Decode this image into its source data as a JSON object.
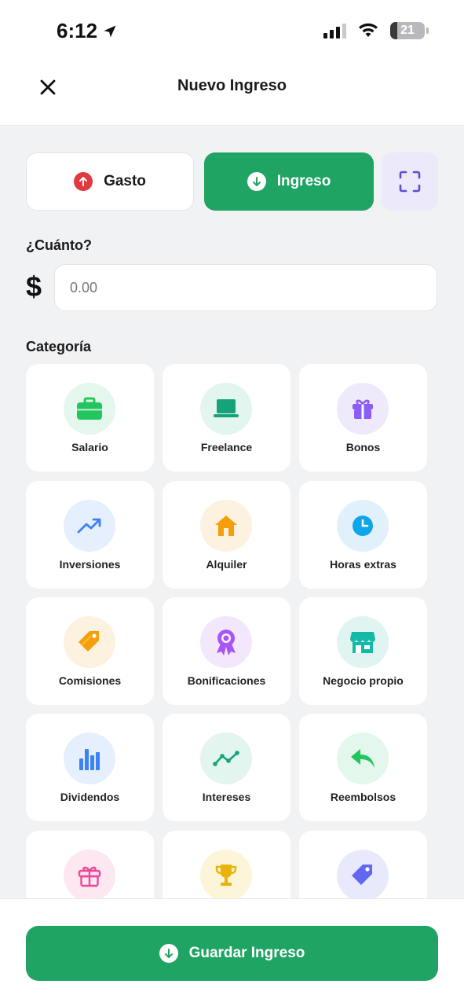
{
  "status_bar": {
    "time": "6:12",
    "battery_level": "21"
  },
  "header": {
    "title": "Nuevo Ingreso"
  },
  "type_toggle": {
    "expense_label": "Gasto",
    "income_label": "Ingreso",
    "selected": "Ingreso",
    "income_color": "#1fa463",
    "expense_icon_color": "#e0393e"
  },
  "amount": {
    "label": "¿Cuánto?",
    "currency_symbol": "$",
    "placeholder": "0.00",
    "value": ""
  },
  "category": {
    "label": "Categoría",
    "items": [
      {
        "label": "Salario",
        "icon": "briefcase-icon",
        "icon_color": "#22c55e",
        "bg": "#e4f7ec"
      },
      {
        "label": "Freelance",
        "icon": "laptop-icon",
        "icon_color": "#16a37a",
        "bg": "#e2f5ee"
      },
      {
        "label": "Bonos",
        "icon": "gift-icon",
        "icon_color": "#8b5cf6",
        "bg": "#efe9fc"
      },
      {
        "label": "Inversiones",
        "icon": "trending-up-icon",
        "icon_color": "#3b82f6",
        "bg": "#e6effd"
      },
      {
        "label": "Alquiler",
        "icon": "home-icon",
        "icon_color": "#f59e0b",
        "bg": "#fdf1df"
      },
      {
        "label": "Horas extras",
        "icon": "clock-icon",
        "icon_color": "#0ea5e9",
        "bg": "#e1f1fb"
      },
      {
        "label": "Comisiones",
        "icon": "tag-icon",
        "icon_color": "#f59e0b",
        "bg": "#fdf1df"
      },
      {
        "label": "Bonificaciones",
        "icon": "award-icon",
        "icon_color": "#a855f7",
        "bg": "#f3e7fd"
      },
      {
        "label": "Negocio propio",
        "icon": "store-icon",
        "icon_color": "#14b8a6",
        "bg": "#e0f5f2"
      },
      {
        "label": "Dividendos",
        "icon": "bar-chart-icon",
        "icon_color": "#3b82f6",
        "bg": "#e6effd"
      },
      {
        "label": "Intereses",
        "icon": "line-chart-icon",
        "icon_color": "#16a37a",
        "bg": "#e2f5ee"
      },
      {
        "label": "Reembolsos",
        "icon": "reply-icon",
        "icon_color": "#22c55e",
        "bg": "#e4f7ec"
      },
      {
        "label": "",
        "icon": "gift-outline-icon",
        "icon_color": "#ec4899",
        "bg": "#fde7f1"
      },
      {
        "label": "",
        "icon": "trophy-icon",
        "icon_color": "#eab308",
        "bg": "#fdf5d9"
      },
      {
        "label": "",
        "icon": "tag-icon",
        "icon_color": "#6366f1",
        "bg": "#e9e9fc"
      }
    ]
  },
  "footer": {
    "save_label": "Guardar Ingreso"
  }
}
